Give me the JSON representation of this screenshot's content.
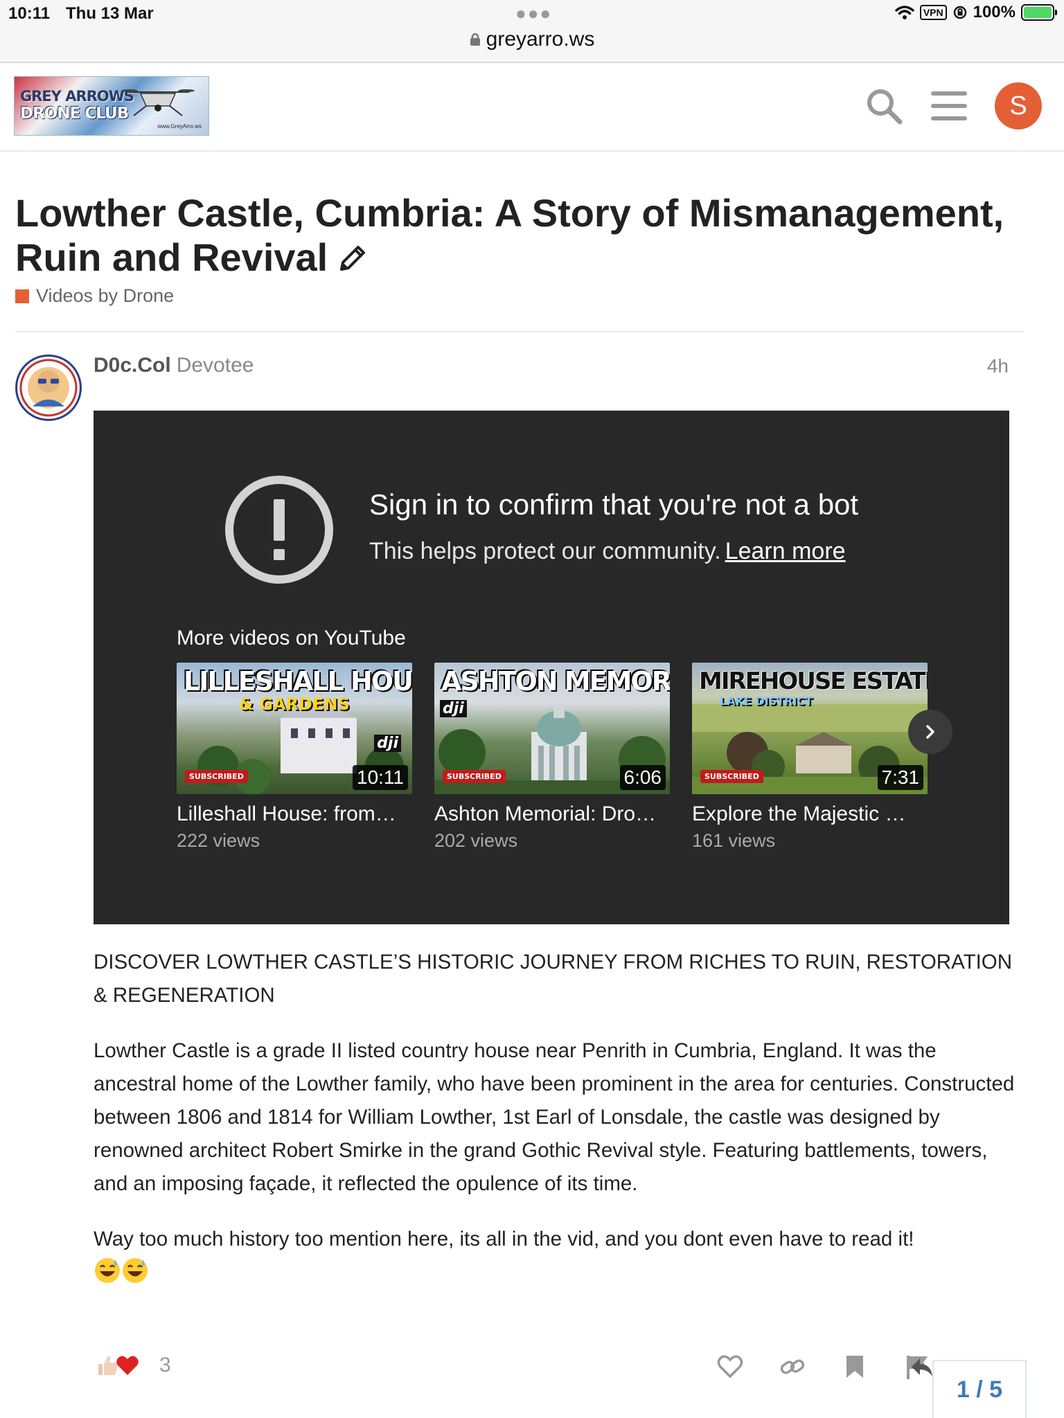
{
  "status_bar": {
    "time": "10:11",
    "date": "Thu 13 Mar",
    "battery": "100%",
    "vpn": "VPN"
  },
  "browser": {
    "url": "greyarro.ws"
  },
  "site": {
    "logo_line1": "GREY ARROWS",
    "logo_line2": "DRONE CLUB",
    "logo_url": "www.GreyArro.ws",
    "user_initial": "S"
  },
  "topic": {
    "title": "Lowther Castle, Cumbria: A Story of Mismanagement, Ruin and Revival",
    "category": "Videos by Drone",
    "category_color": "#e45f35"
  },
  "post": {
    "author": "D0c.Col",
    "rank": "Devotee",
    "time": "4h",
    "embed": {
      "heading": "Sign in to confirm that you're not a bot",
      "subtext": "This helps protect our community.",
      "learn_more": "Learn more",
      "more_videos": "More videos on YouTube",
      "videos": [
        {
          "thumb_title": "LILLESHALL HOUSE",
          "thumb_subtitle": "& GARDENS",
          "badge": "SUBSCRIBED",
          "duration": "10:11",
          "title": "Lilleshall House: from…",
          "views": "222 views"
        },
        {
          "thumb_title": "ASHTON MEMORIAL",
          "thumb_subtitle": "",
          "badge": "SUBSCRIBED",
          "duration": "6:06",
          "title": "Ashton Memorial: Dro…",
          "views": "202 views"
        },
        {
          "thumb_title": "MIREHOUSE ESTATE",
          "thumb_subtitle": "LAKE DISTRICT",
          "badge": "SUBSCRIBED",
          "duration": "7:31",
          "title": "Explore the Majestic …",
          "views": "161 views"
        }
      ]
    },
    "body": {
      "headline": "DISCOVER LOWTHER CASTLE’S HISTORIC JOURNEY FROM RICHES TO RUIN, RESTORATION & REGENERATION",
      "paragraph": "Lowther Castle is a grade II listed country house near Penrith in Cumbria, England. It was the ancestral home of the Lowther family, who have been prominent in the area for centuries. Constructed between 1806 and 1814 for William Lowther, 1st Earl of Lonsdale, the castle was designed by renowned architect Robert Smirke in the grand Gothic Revival style. Featuring battlements, towers, and an imposing façade, it reflected the opulence of its time.",
      "closing": "Way too much history too mention here, its all in the vid, and you dont even have to read it!"
    },
    "reaction_count": "3"
  },
  "timeline": {
    "progress": "1 / 5"
  }
}
